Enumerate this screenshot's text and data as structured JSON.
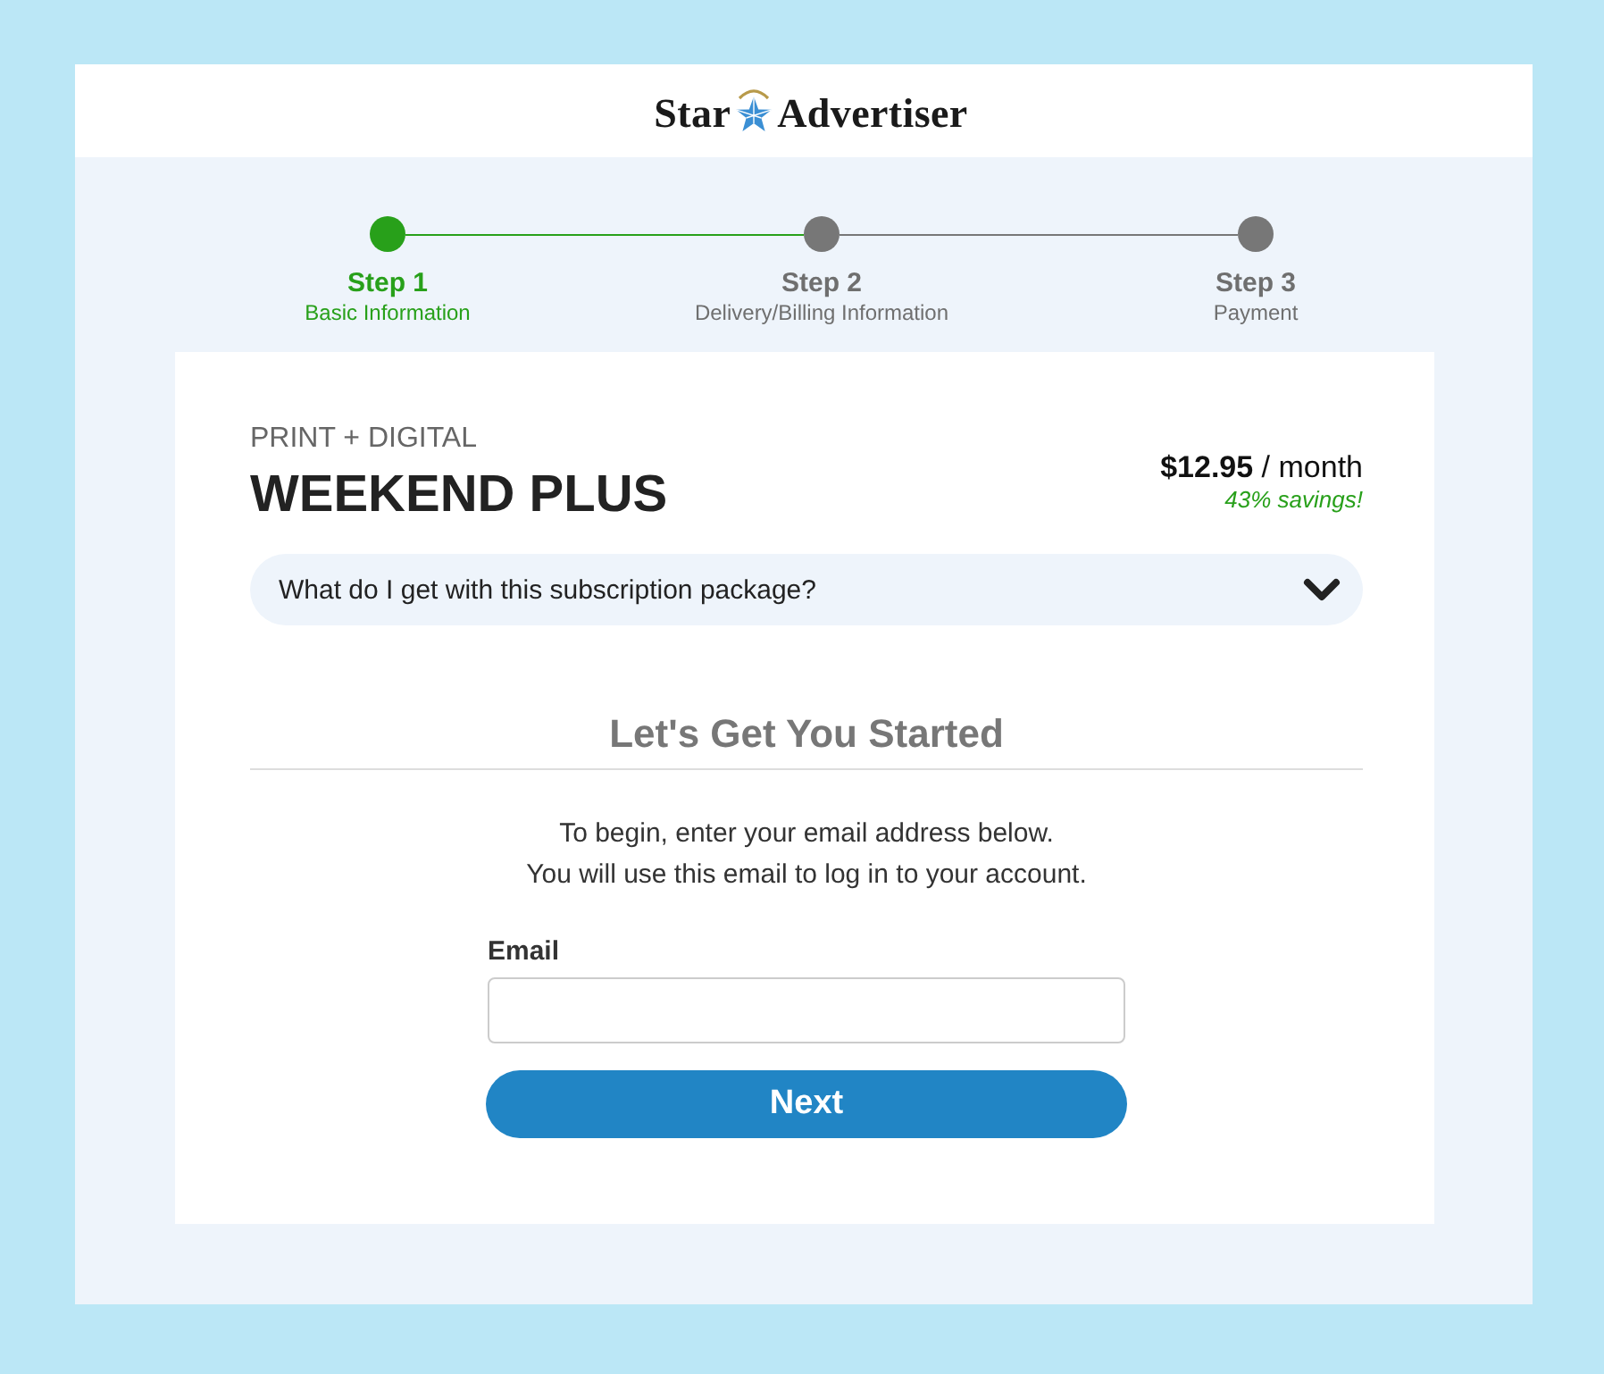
{
  "header": {
    "logo": {
      "left": "Star",
      "right": "Advertiser"
    }
  },
  "steps": [
    {
      "title": "Step 1",
      "subtitle": "Basic Information",
      "current": true
    },
    {
      "title": "Step 2",
      "subtitle": "Delivery/Billing Information",
      "current": false
    },
    {
      "title": "Step 3",
      "subtitle": "Payment",
      "current": false
    }
  ],
  "plan": {
    "category": "PRINT + DIGITAL",
    "name": "WEEKEND PLUS",
    "price": "**$12.95** / month",
    "savings": "43% savings!"
  },
  "details": {
    "question": "What do I get with this subscription package?",
    "expanded": false
  },
  "form": {
    "heading": "Let's Get You Started",
    "intro": [
      "To begin, enter your email address below.",
      "You will use this email to log in to your account."
    ],
    "email_label": "Email",
    "button": "Next"
  }
}
